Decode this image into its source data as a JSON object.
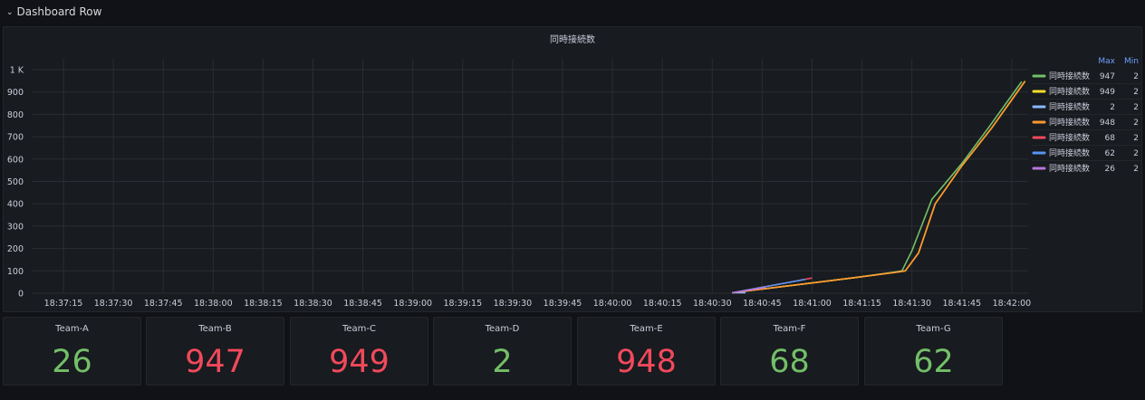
{
  "row": {
    "title": "Dashboard Row"
  },
  "chart_data": {
    "type": "line",
    "title": "同時接続数",
    "xlabel": "",
    "ylabel": "",
    "x_ticks": [
      "18:37:15",
      "18:37:30",
      "18:37:45",
      "18:38:00",
      "18:38:15",
      "18:38:30",
      "18:38:45",
      "18:39:00",
      "18:39:15",
      "18:39:30",
      "18:39:45",
      "18:40:00",
      "18:40:15",
      "18:40:30",
      "18:40:45",
      "18:41:00",
      "18:41:15",
      "18:41:30",
      "18:41:45",
      "18:42:00"
    ],
    "y_ticks": [
      "0",
      "100",
      "200",
      "300",
      "400",
      "500",
      "600",
      "700",
      "800",
      "900",
      "1 K"
    ],
    "ylim": [
      0,
      1000
    ],
    "grid": true,
    "legend_position": "right",
    "legend_headers": [
      "Max",
      "Min"
    ],
    "series": [
      {
        "name": "同時接続数",
        "color": "#73bf69",
        "max": "947",
        "min": "2",
        "x": [
          "18:40:36",
          "18:41:13",
          "18:41:25",
          "18:41:27",
          "18:41:30",
          "18:41:36",
          "18:41:45",
          "18:41:53",
          "18:42:03"
        ],
        "values": [
          2,
          70,
          95,
          100,
          190,
          420,
          580,
          740,
          947
        ]
      },
      {
        "name": "同時接続数",
        "color": "#fade2a",
        "max": "949",
        "min": "2",
        "x": [
          "18:40:36",
          "18:41:13",
          "18:41:26",
          "18:41:28",
          "18:41:32",
          "18:41:37",
          "18:41:45",
          "18:41:54",
          "18:42:04"
        ],
        "values": [
          2,
          70,
          95,
          100,
          180,
          400,
          570,
          740,
          949
        ]
      },
      {
        "name": "同時接続数",
        "color": "#8ab8ff",
        "max": "2",
        "min": "2",
        "x": [
          "18:40:36",
          "18:40:40"
        ],
        "values": [
          2,
          2
        ]
      },
      {
        "name": "同時接続数",
        "color": "#ff9830",
        "max": "948",
        "min": "2",
        "x": [
          "18:40:36",
          "18:41:13",
          "18:41:26",
          "18:41:28",
          "18:41:32",
          "18:41:37",
          "18:41:45",
          "18:41:54",
          "18:42:04"
        ],
        "values": [
          2,
          70,
          95,
          100,
          180,
          400,
          570,
          740,
          948
        ]
      },
      {
        "name": "同時接続数",
        "color": "#f2495c",
        "max": "68",
        "min": "2",
        "x": [
          "18:40:36",
          "18:41:00"
        ],
        "values": [
          2,
          68
        ]
      },
      {
        "name": "同時接続数",
        "color": "#5794f2",
        "max": "62",
        "min": "2",
        "x": [
          "18:40:36",
          "18:40:58"
        ],
        "values": [
          2,
          62
        ]
      },
      {
        "name": "同時接続数",
        "color": "#b877d9",
        "max": "26",
        "min": "2",
        "x": [
          "18:40:36",
          "18:40:46"
        ],
        "values": [
          2,
          26
        ]
      }
    ]
  },
  "stats": [
    {
      "title": "Team-A",
      "value": "26",
      "color": "#73bf69"
    },
    {
      "title": "Team-B",
      "value": "947",
      "color": "#f2495c"
    },
    {
      "title": "Team-C",
      "value": "949",
      "color": "#f2495c"
    },
    {
      "title": "Team-D",
      "value": "2",
      "color": "#73bf69"
    },
    {
      "title": "Team-E",
      "value": "948",
      "color": "#f2495c"
    },
    {
      "title": "Team-F",
      "value": "68",
      "color": "#73bf69"
    },
    {
      "title": "Team-G",
      "value": "62",
      "color": "#73bf69"
    }
  ]
}
